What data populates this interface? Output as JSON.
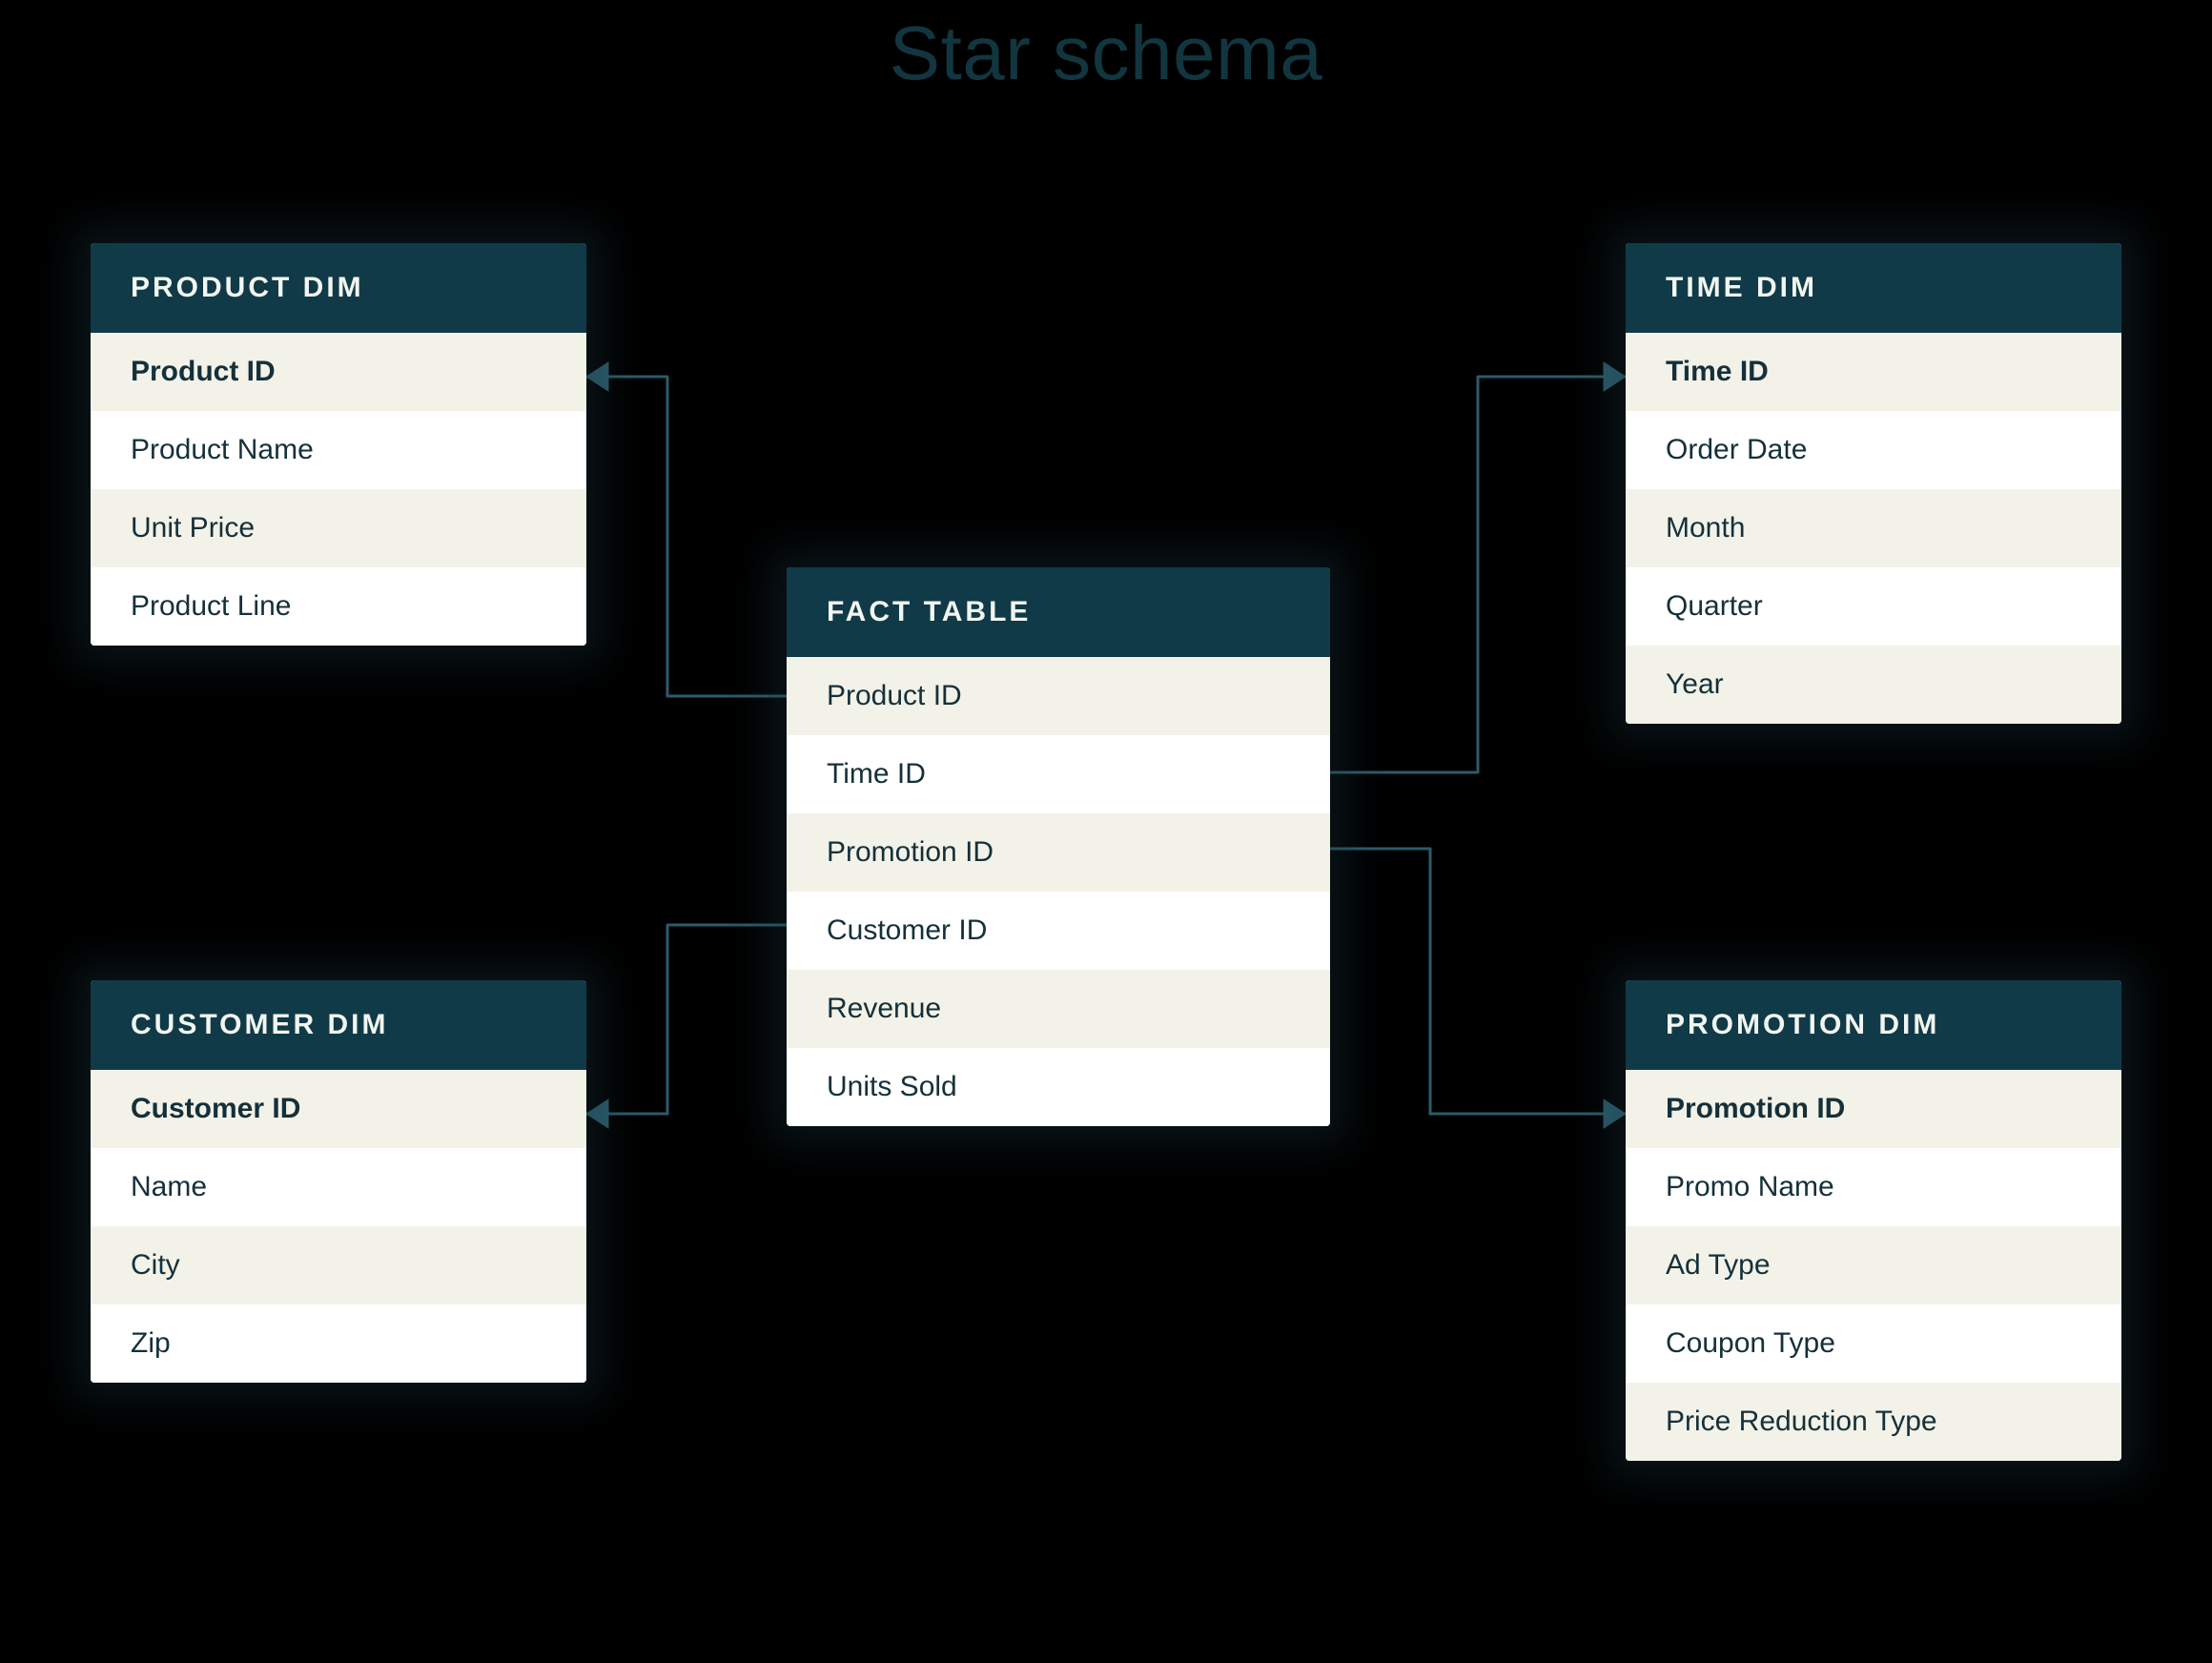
{
  "title": "Star schema",
  "colors": {
    "header_bg": "#103a47",
    "row_alt_bg": "#f2f2e8",
    "row_bg": "#ffffff",
    "text": "#15303a",
    "connector": "#2b5b6a",
    "bg": "#000000"
  },
  "tables": {
    "product_dim": {
      "title": "PRODUCT DIM",
      "key_field": "Product ID",
      "fields": [
        "Product ID",
        "Product Name",
        "Unit Price",
        "Product Line"
      ]
    },
    "time_dim": {
      "title": "TIME DIM",
      "key_field": "Time ID",
      "fields": [
        "Time ID",
        "Order Date",
        "Month",
        "Quarter",
        "Year"
      ]
    },
    "fact": {
      "title": "FACT TABLE",
      "fields": [
        "Product ID",
        "Time ID",
        "Promotion ID",
        "Customer ID",
        "Revenue",
        "Units Sold"
      ]
    },
    "customer_dim": {
      "title": "CUSTOMER DIM",
      "key_field": "Customer ID",
      "fields": [
        "Customer ID",
        "Name",
        "City",
        "Zip"
      ]
    },
    "promotion_dim": {
      "title": "PROMOTION DIM",
      "key_field": "Promotion ID",
      "fields": [
        "Promotion ID",
        "Promo Name",
        "Ad Type",
        "Coupon Type",
        "Price Reduction Type"
      ]
    }
  },
  "relationships": [
    {
      "from": "fact.Product ID",
      "to": "product_dim.Product ID"
    },
    {
      "from": "fact.Time ID",
      "to": "time_dim.Time ID"
    },
    {
      "from": "fact.Promotion ID",
      "to": "promotion_dim.Promotion ID"
    },
    {
      "from": "fact.Customer ID",
      "to": "customer_dim.Customer ID"
    }
  ]
}
